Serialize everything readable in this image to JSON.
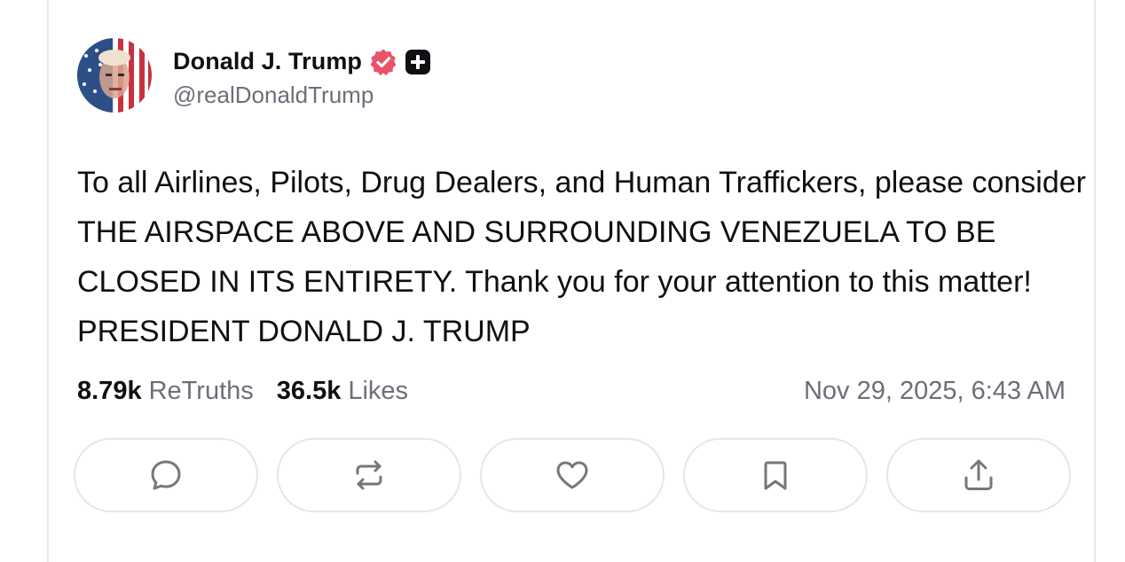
{
  "post": {
    "author": {
      "display_name": "Donald J. Trump",
      "handle": "@realDonaldTrump",
      "verified_badge_color": "#e8536a",
      "avatar_icon": "user-avatar-flag"
    },
    "text": "To all Airlines, Pilots, Drug Dealers, and Human Traffickers, please consider THE AIRSPACE ABOVE AND SURROUNDING VENEZUELA TO BE CLOSED IN ITS ENTIRETY. Thank you for your attention to this matter! PRESIDENT DONALD J. TRUMP",
    "stats": {
      "retruths_count": "8.79k",
      "retruths_label": "ReTruths",
      "likes_count": "36.5k",
      "likes_label": "Likes"
    },
    "timestamp": "Nov 29, 2025, 6:43 AM"
  },
  "actions": [
    {
      "name": "reply",
      "icon": "comment-icon"
    },
    {
      "name": "retruth",
      "icon": "repost-icon"
    },
    {
      "name": "like",
      "icon": "heart-icon"
    },
    {
      "name": "bookmark",
      "icon": "bookmark-icon"
    },
    {
      "name": "share",
      "icon": "share-icon"
    }
  ],
  "colors": {
    "text_primary": "#0f0f14",
    "text_secondary": "#6e6e7a",
    "border": "#e6e6ea",
    "icon": "#76767f"
  }
}
